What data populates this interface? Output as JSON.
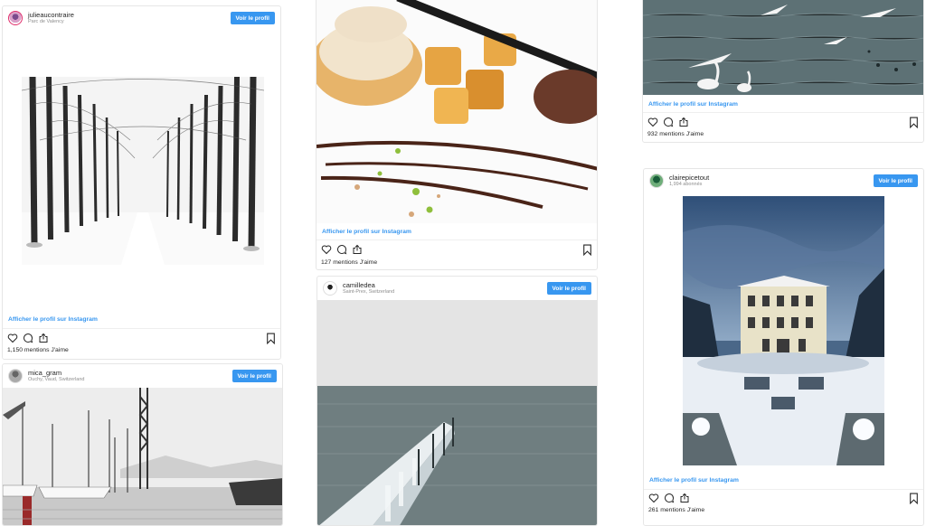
{
  "common": {
    "follow_label": "Voir le profil",
    "view_profile_link": "Afficher le profil sur Instagram",
    "accent": "#3897f0"
  },
  "posts": [
    {
      "username": "julieaucontraire",
      "location": "Parc de Valency",
      "likes": "1,150 mentions J'aime",
      "photo": "snowy-tree-avenue"
    },
    {
      "username": "",
      "location": "",
      "likes": "127 mentions J'aime",
      "photo": "plated-dessert"
    },
    {
      "username": "",
      "location": "",
      "likes": "932 mentions J'aime",
      "photo": "lake-with-swans"
    },
    {
      "username": "mica_gram",
      "location": "Ouchy, Vaud, Switzerland",
      "likes": "",
      "photo": "harbor-sailboats"
    },
    {
      "username": "camilledea",
      "location": "Saint-Prex, Switzerland",
      "likes": "",
      "photo": "frozen-pier-lake"
    },
    {
      "username": "clairepicetout",
      "location": "1,994 abonnés",
      "likes": "261 mentions J'aime",
      "photo": "snowy-villa"
    }
  ],
  "icons": [
    "heart-icon",
    "comment-icon",
    "share-icon",
    "bookmark-icon"
  ]
}
